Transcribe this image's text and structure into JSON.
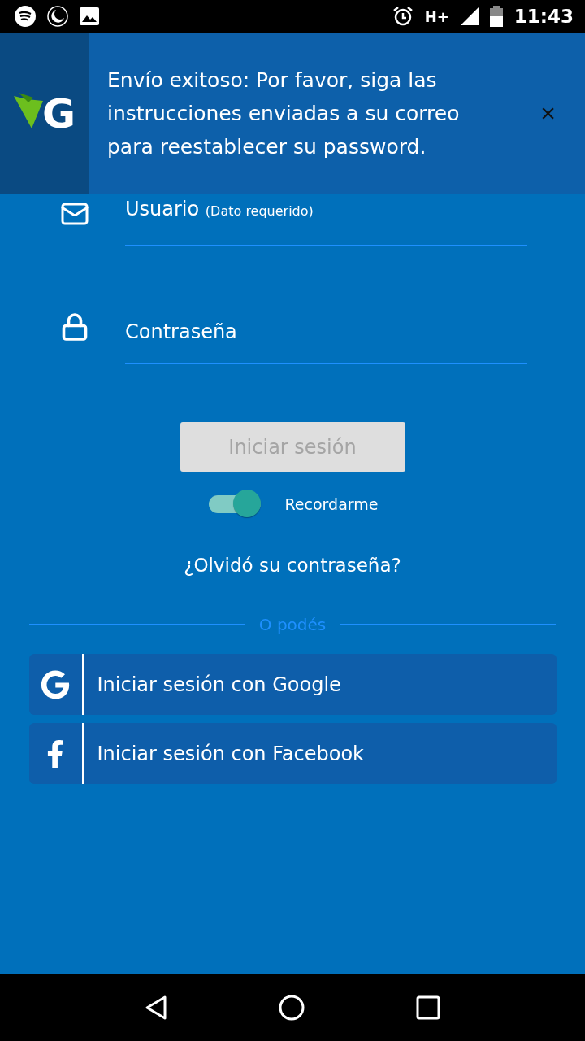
{
  "status_bar": {
    "network": "H+",
    "time": "11:43"
  },
  "toast": {
    "logo_letter": "G",
    "message": "Envío exitoso: Por favor, siga las instrucciones enviadas a su correo para reestablecer su password.",
    "close": "×"
  },
  "fields": [
    {
      "kind": "email",
      "label": "Usuario",
      "hint": "(Dato requerido)"
    },
    {
      "kind": "password",
      "label": "Contraseña"
    }
  ],
  "login_button": {
    "label": "Iniciar sesión",
    "disabled": true
  },
  "remember": {
    "label": "Recordarme",
    "on": true
  },
  "forgot_link": "¿Olvidó su contraseña?",
  "divider": "O podés",
  "social_buttons": [
    {
      "kind": "google",
      "label": "Iniciar sesión con Google"
    },
    {
      "kind": "facebook",
      "label": "Iniciar sesión con Facebook"
    }
  ]
}
